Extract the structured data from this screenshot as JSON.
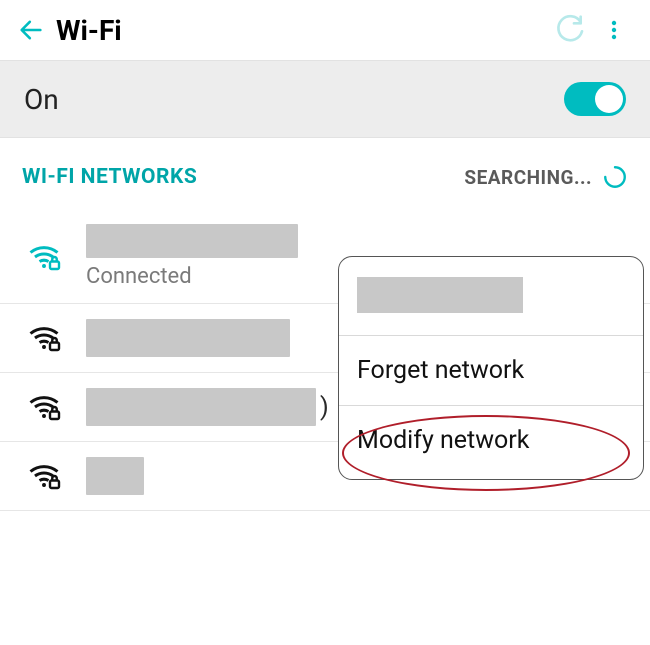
{
  "header": {
    "title": "Wi-Fi"
  },
  "toggle": {
    "state_label": "On",
    "enabled": true
  },
  "section": {
    "title": "WI-FI NETWORKS",
    "status": "SEARCHING..."
  },
  "networks": [
    {
      "ssid": "",
      "status": "Connected",
      "connected": true,
      "secured": true
    },
    {
      "ssid": "",
      "status": "",
      "connected": false,
      "secured": true
    },
    {
      "ssid": "",
      "status": "",
      "connected": false,
      "secured": true
    },
    {
      "ssid": "",
      "status": "",
      "connected": false,
      "secured": true
    }
  ],
  "popup": {
    "ssid": "",
    "items": [
      {
        "label": "Forget network"
      },
      {
        "label": "Modify network"
      }
    ]
  },
  "colors": {
    "accent": "#00bcc0",
    "highlight": "#b01e2a"
  }
}
